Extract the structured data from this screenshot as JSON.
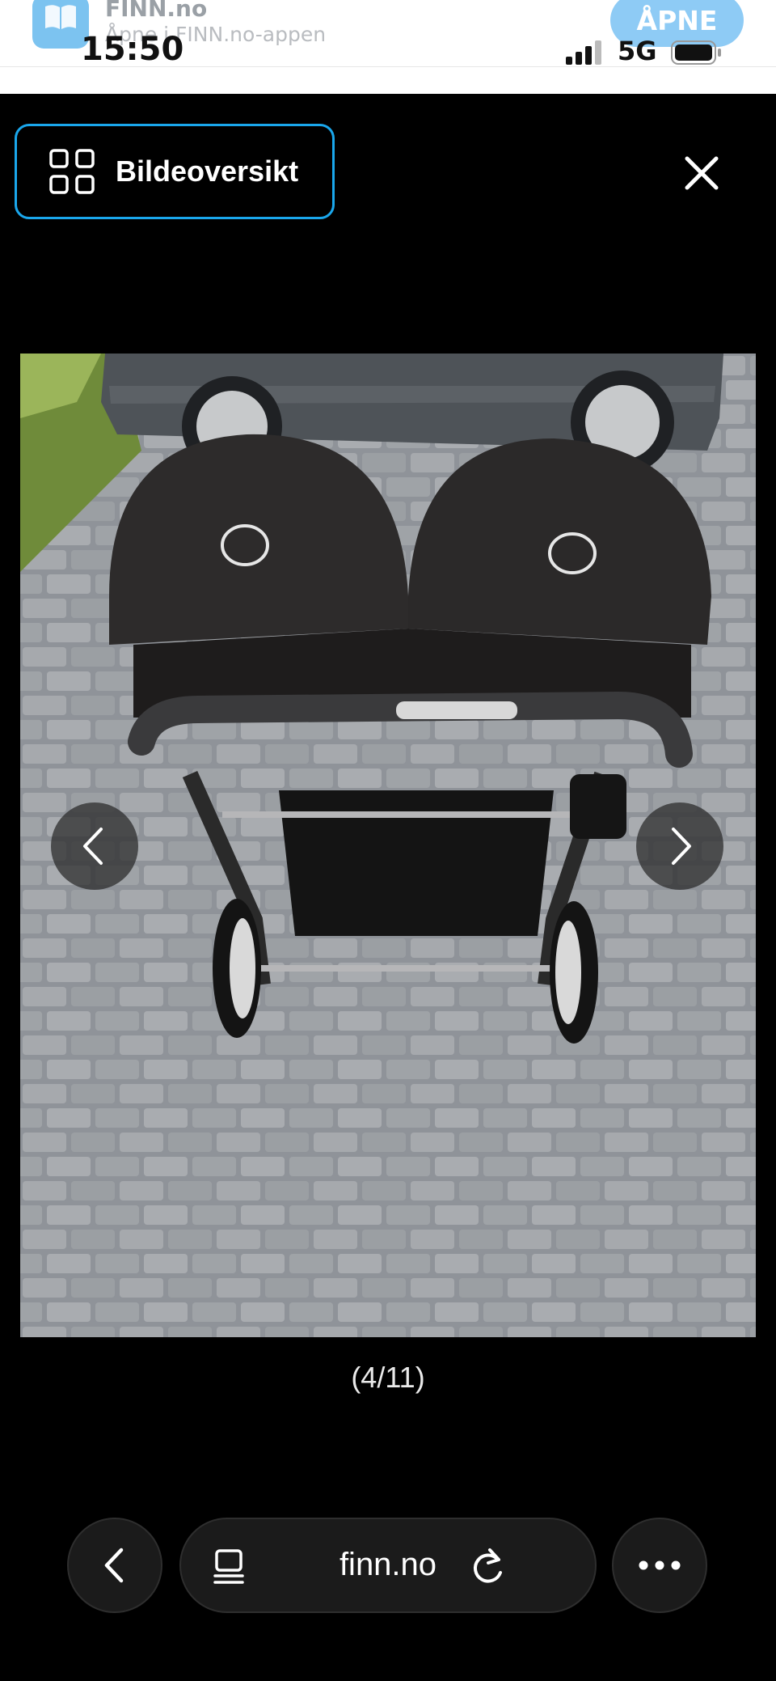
{
  "app_banner": {
    "app_name": "FINN.no",
    "subtitle": "Åpne i FINN.no-appen",
    "open_label": "ÅPNE"
  },
  "status_bar": {
    "time": "15:50",
    "network": "5G"
  },
  "gallery": {
    "overview_label": "Bildeoversikt",
    "counter": "(4/11)",
    "current_image": 4,
    "total_images": 11
  },
  "browser": {
    "url": "finn.no"
  },
  "colors": {
    "accent": "#1aa7ec",
    "background": "#000000"
  }
}
